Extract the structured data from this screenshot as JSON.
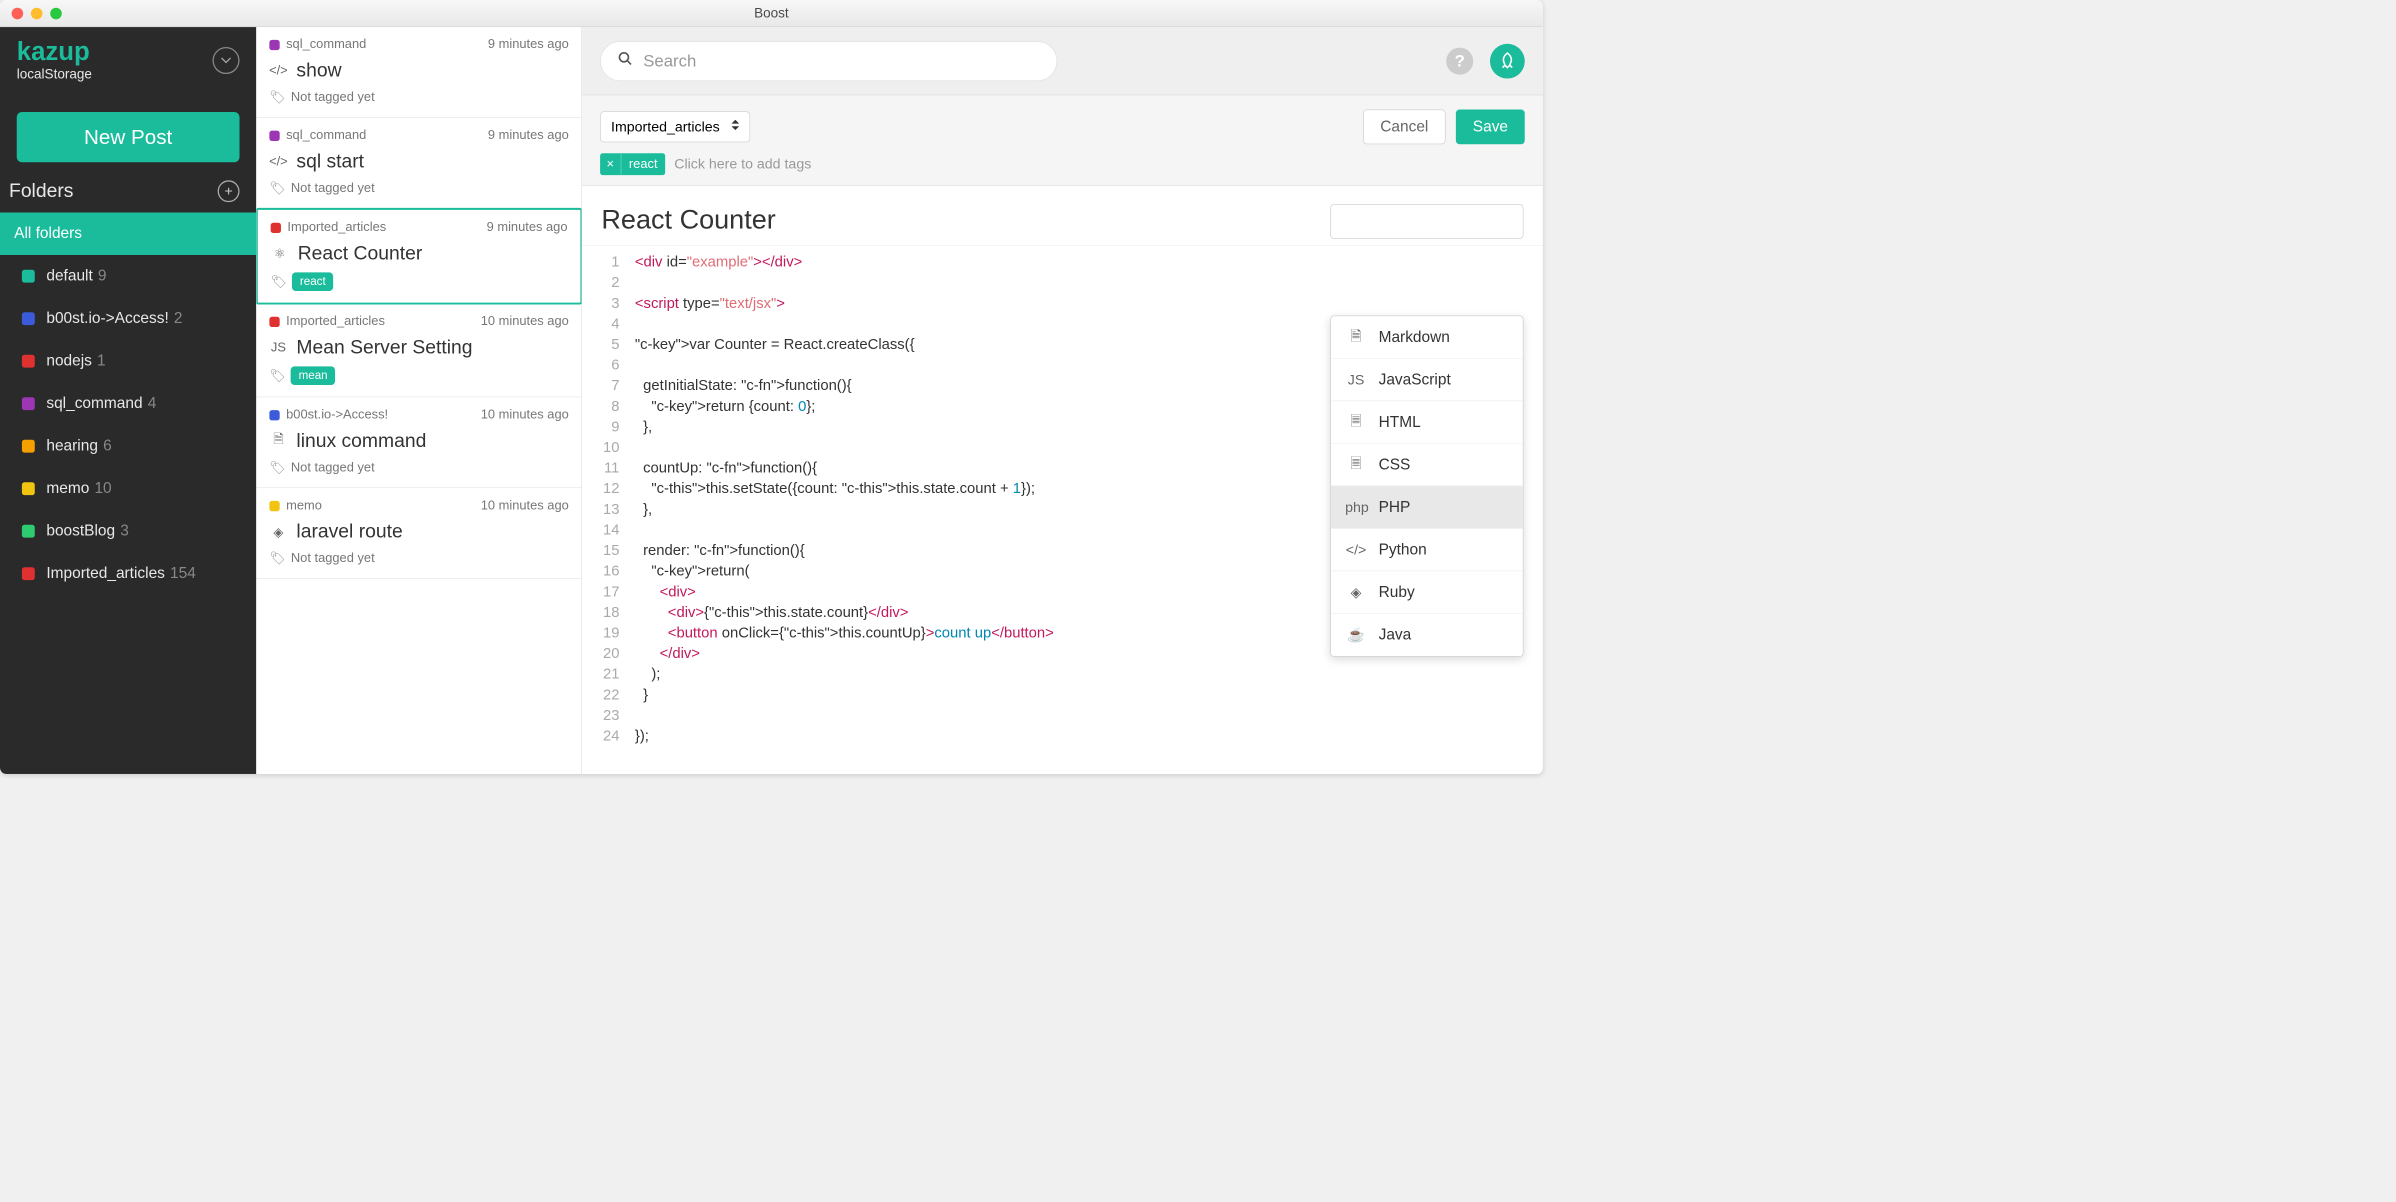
{
  "window": {
    "title": "Boost"
  },
  "brand": {
    "name": "kazup",
    "storage": "localStorage"
  },
  "sidebar": {
    "newPost": "New Post",
    "foldersHeader": "Folders",
    "allFolders": "All folders",
    "folders": [
      {
        "name": "default",
        "count": "9",
        "color": "#1abc9c"
      },
      {
        "name": "b00st.io->Access!",
        "count": "2",
        "color": "#3b5bdb"
      },
      {
        "name": "nodejs",
        "count": "1",
        "color": "#e03131"
      },
      {
        "name": "sql_command",
        "count": "4",
        "color": "#9c36b5"
      },
      {
        "name": "hearing",
        "count": "6",
        "color": "#f59f00"
      },
      {
        "name": "memo",
        "count": "10",
        "color": "#f1c40f"
      },
      {
        "name": "boostBlog",
        "count": "3",
        "color": "#2ecc71"
      },
      {
        "name": "Imported_articles",
        "count": "154",
        "color": "#e03131"
      }
    ]
  },
  "search": {
    "placeholder": "Search"
  },
  "notes": [
    {
      "folder": "sql_command",
      "color": "#9c36b5",
      "time": "9 minutes ago",
      "icon": "code",
      "title": "show",
      "tagText": "Not tagged yet",
      "tags": []
    },
    {
      "folder": "sql_command",
      "color": "#9c36b5",
      "time": "9 minutes ago",
      "icon": "code",
      "title": "sql start",
      "tagText": "Not tagged yet",
      "tags": []
    },
    {
      "folder": "Imported_articles",
      "color": "#e03131",
      "time": "9 minutes ago",
      "icon": "react",
      "title": "React Counter",
      "tagText": "",
      "tags": [
        "react"
      ]
    },
    {
      "folder": "Imported_articles",
      "color": "#e03131",
      "time": "10 minutes ago",
      "icon": "js",
      "title": "Mean Server Setting",
      "tagText": "",
      "tags": [
        "mean"
      ]
    },
    {
      "folder": "b00st.io->Access!",
      "color": "#3b5bdb",
      "time": "10 minutes ago",
      "icon": "doc",
      "title": "linux command",
      "tagText": "Not tagged yet",
      "tags": []
    },
    {
      "folder": "memo",
      "color": "#f1c40f",
      "time": "10 minutes ago",
      "icon": "ruby",
      "title": "laravel route",
      "tagText": "Not tagged yet",
      "tags": []
    }
  ],
  "noteSelectedIndex": 2,
  "editor": {
    "folderSelect": "Imported_articles",
    "cancel": "Cancel",
    "save": "Save",
    "tag": "react",
    "tagHint": "Click here to add tags",
    "title": "React Counter",
    "code": "<div id=\"example\"></div>\n\n<script type=\"text/jsx\">\n\nvar Counter = React.createClass({\n\n  getInitialState: function(){\n    return {count: 0};\n  },\n\n  countUp: function(){\n    this.setState({count: this.state.count + 1});\n  },\n\n  render: function(){\n    return(\n      <div>\n        <div>{this.state.count}</div>\n        <button onClick={this.countUp}>count up</button>\n      </div>\n    );\n  }\n\n});",
    "lineStart": 1,
    "lineEnd": 24
  },
  "langMenu": {
    "items": [
      "Markdown",
      "JavaScript",
      "HTML",
      "CSS",
      "PHP",
      "Python",
      "Ruby",
      "Java"
    ],
    "highlight": 4
  }
}
